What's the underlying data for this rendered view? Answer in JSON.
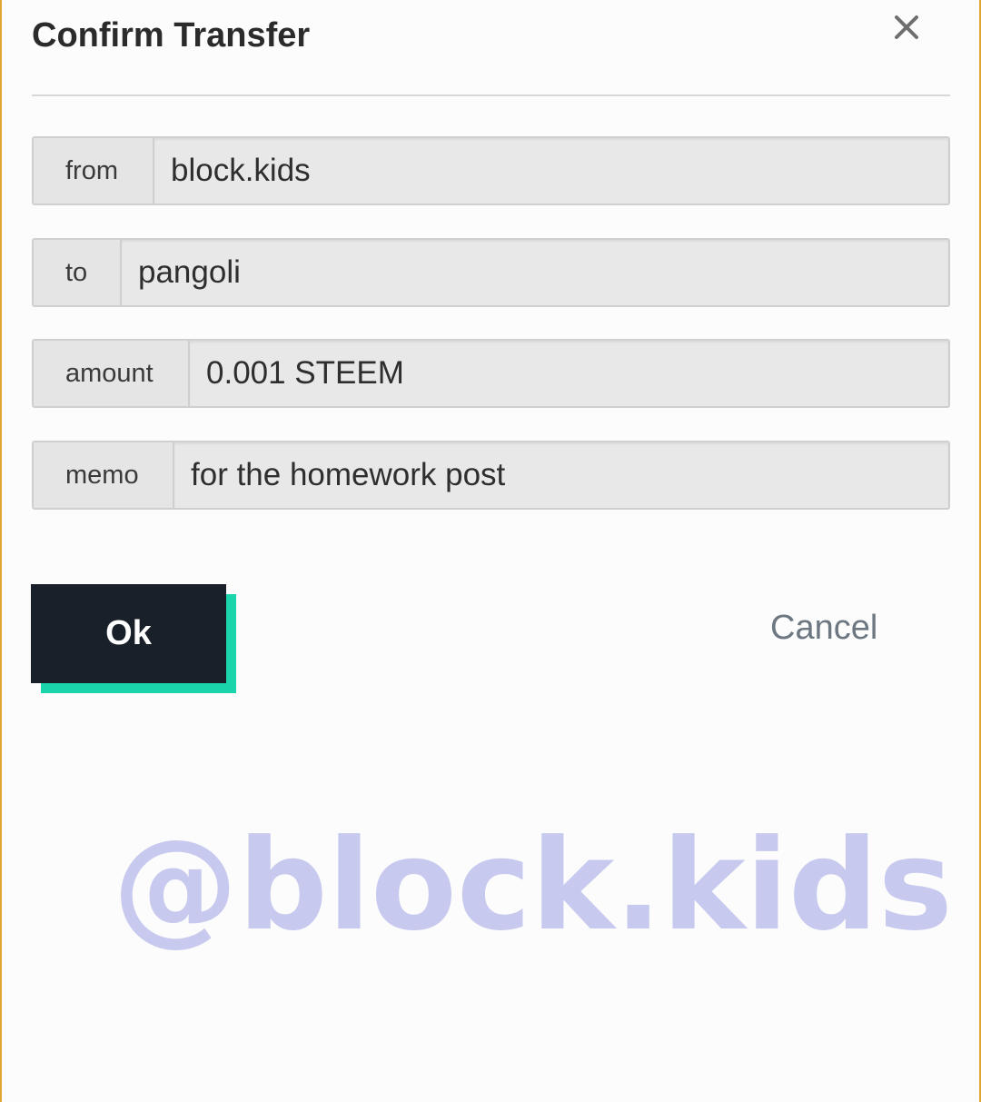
{
  "dialog": {
    "title": "Confirm Transfer",
    "close_icon": "close-icon"
  },
  "fields": {
    "from": {
      "label": "from",
      "value": "block.kids"
    },
    "to": {
      "label": "to",
      "value": "pangoli"
    },
    "amount": {
      "label": "amount",
      "value": "0.001 STEEM"
    },
    "memo": {
      "label": "memo",
      "value": "for the homework post"
    }
  },
  "actions": {
    "ok_label": "Ok",
    "cancel_label": "Cancel"
  },
  "watermark": "@block.kids",
  "colors": {
    "ok_background": "#19202a",
    "ok_accent_shadow": "#1ad4ac",
    "cancel_text": "#6d7782",
    "field_background": "#e7e7e7",
    "watermark": "#c7caee",
    "frame_edge": "#e0a832"
  }
}
